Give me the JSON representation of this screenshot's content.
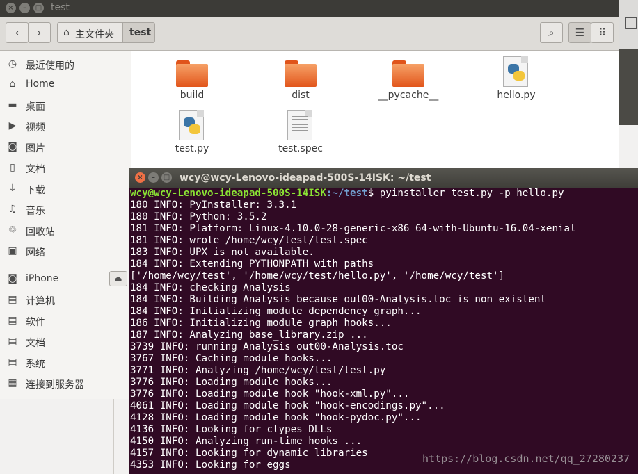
{
  "file_manager": {
    "window_title": "test",
    "breadcrumb": {
      "home_label": "主文件夹",
      "current_label": "test"
    },
    "sidebar": {
      "places": [
        {
          "label": "最近使用的",
          "icon": "clock-icon"
        },
        {
          "label": "Home",
          "icon": "home-icon"
        },
        {
          "label": "桌面",
          "icon": "desktop-folder-icon"
        },
        {
          "label": "视频",
          "icon": "video-icon"
        },
        {
          "label": "图片",
          "icon": "camera-icon"
        },
        {
          "label": "文档",
          "icon": "document-icon"
        },
        {
          "label": "下载",
          "icon": "download-icon"
        },
        {
          "label": "音乐",
          "icon": "music-icon"
        },
        {
          "label": "回收站",
          "icon": "trash-icon"
        },
        {
          "label": "网络",
          "icon": "network-icon"
        }
      ],
      "devices": [
        {
          "label": "iPhone",
          "icon": "camera-icon"
        },
        {
          "label": "计算机",
          "icon": "drive-icon"
        },
        {
          "label": "软件",
          "icon": "drive-icon"
        },
        {
          "label": "文档",
          "icon": "drive-icon"
        },
        {
          "label": "系统",
          "icon": "drive-icon"
        },
        {
          "label": "连接到服务器",
          "icon": "server-icon"
        }
      ]
    },
    "files": [
      {
        "name": "build",
        "kind": "folder"
      },
      {
        "name": "dist",
        "kind": "folder"
      },
      {
        "name": "__pycache__",
        "kind": "folder"
      },
      {
        "name": "hello.py",
        "kind": "python"
      },
      {
        "name": "test.py",
        "kind": "python"
      },
      {
        "name": "test.spec",
        "kind": "text"
      }
    ]
  },
  "terminal": {
    "title": "wcy@wcy-Lenovo-ideapad-500S-14ISK: ~/test",
    "prompt_user": "wcy@wcy-Lenovo-ideapad-500S-14ISK",
    "prompt_path": ":~/test",
    "command": "$ pyinstaller test.py -p hello.py",
    "output": [
      "180 INFO: PyInstaller: 3.3.1",
      "180 INFO: Python: 3.5.2",
      "181 INFO: Platform: Linux-4.10.0-28-generic-x86_64-with-Ubuntu-16.04-xenial",
      "181 INFO: wrote /home/wcy/test/test.spec",
      "183 INFO: UPX is not available.",
      "184 INFO: Extending PYTHONPATH with paths",
      "['/home/wcy/test', '/home/wcy/test/hello.py', '/home/wcy/test']",
      "184 INFO: checking Analysis",
      "184 INFO: Building Analysis because out00-Analysis.toc is non existent",
      "184 INFO: Initializing module dependency graph...",
      "186 INFO: Initializing module graph hooks...",
      "187 INFO: Analyzing base_library.zip ...",
      "3739 INFO: running Analysis out00-Analysis.toc",
      "3767 INFO: Caching module hooks...",
      "3771 INFO: Analyzing /home/wcy/test/test.py",
      "3776 INFO: Loading module hooks...",
      "3776 INFO: Loading module hook \"hook-xml.py\"...",
      "4061 INFO: Loading module hook \"hook-encodings.py\"...",
      "4128 INFO: Loading module hook \"hook-pydoc.py\"...",
      "4136 INFO: Looking for ctypes DLLs",
      "4150 INFO: Analyzing run-time hooks ...",
      "4157 INFO: Looking for dynamic libraries",
      "4353 INFO: Looking for eggs"
    ],
    "watermark": "https://blog.csdn.net/qq_27280237"
  }
}
